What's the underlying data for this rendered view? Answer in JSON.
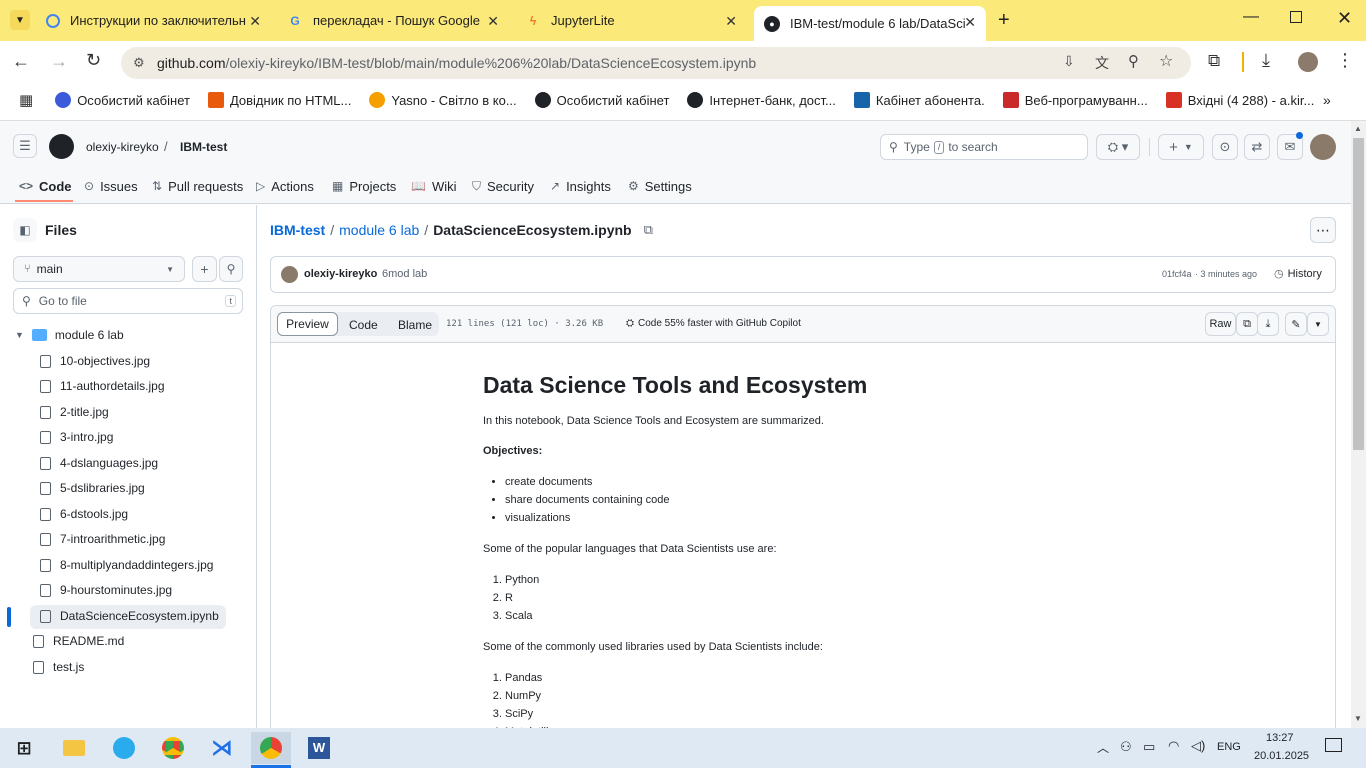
{
  "browser": {
    "tabs": [
      {
        "title": "Инструкции по заключительн",
        "icon": "google-classroom-icon",
        "color": "#4285f4"
      },
      {
        "title": "перекладач - Пошук Google",
        "icon": "google-icon",
        "color": "#ea4335"
      },
      {
        "title": "JupyterLite",
        "icon": "jupyter-icon",
        "color": "#f37726"
      },
      {
        "title": "IBM-test/module 6 lab/DataSci",
        "icon": "github-icon",
        "color": "#1f2328"
      }
    ],
    "url_host": "github.com",
    "url_path": "/olexiy-kireyko/IBM-test/blob/main/module%206%20lab/DataScienceEcosystem.ipynb",
    "bookmarks": [
      {
        "label": "Особистий кабінет",
        "color": "#3b5bdb"
      },
      {
        "label": "Довідник по HTML...",
        "color": "#e8590c"
      },
      {
        "label": "Yasno - Світло в ко...",
        "color": "#f59f00"
      },
      {
        "label": "Особистий кабінет",
        "color": "#1f2328"
      },
      {
        "label": "Інтернет-банк, дост...",
        "color": "#1f2328"
      },
      {
        "label": "Кабінет абонента.",
        "color": "#1864ab"
      },
      {
        "label": "Веб-програмуванн...",
        "color": "#c92a2a"
      },
      {
        "label": "Вхідні (4 288) - a.kir...",
        "color": "#d93025"
      }
    ]
  },
  "github": {
    "owner": "olexiy-kireyko",
    "repo": "IBM-test",
    "search_placeholder_before": "Type",
    "search_key": "/",
    "search_placeholder_after": "to search",
    "nav": [
      {
        "label": "Code",
        "icon": "code-icon"
      },
      {
        "label": "Issues",
        "icon": "issue-icon"
      },
      {
        "label": "Pull requests",
        "icon": "pull-request-icon"
      },
      {
        "label": "Actions",
        "icon": "play-icon"
      },
      {
        "label": "Projects",
        "icon": "table-icon"
      },
      {
        "label": "Wiki",
        "icon": "book-icon"
      },
      {
        "label": "Security",
        "icon": "shield-icon"
      },
      {
        "label": "Insights",
        "icon": "graph-icon"
      },
      {
        "label": "Settings",
        "icon": "gear-icon"
      }
    ]
  },
  "sidebar": {
    "title": "Files",
    "branch": "main",
    "goto_placeholder": "Go to file",
    "goto_key": "t",
    "folder": "module 6 lab",
    "files": [
      "10-objectives.jpg",
      "11-authordetails.jpg",
      "2-title.jpg",
      "3-intro.jpg",
      "4-dslanguages.jpg",
      "5-dslibraries.jpg",
      "6-dstools.jpg",
      "7-introarithmetic.jpg",
      "8-multiplyandaddintegers.jpg",
      "9-hourstominutes.jpg",
      "DataScienceEcosystem.ipynb"
    ],
    "root_files": [
      "README.md",
      "test.js"
    ]
  },
  "file": {
    "breadcrumb_repo": "IBM-test",
    "breadcrumb_folder": "module 6 lab",
    "breadcrumb_file": "DataScienceEcosystem.ipynb",
    "commit_author": "olexiy-kireyko",
    "commit_message": "6mod lab",
    "commit_sha": "01fcf4a",
    "commit_time": "· 3 minutes ago",
    "history_label": "History",
    "tab_preview": "Preview",
    "tab_code": "Code",
    "tab_blame": "Blame",
    "stats": "121 lines (121 loc) · 3.26 KB",
    "copilot": "Code 55% faster with GitHub Copilot",
    "raw_label": "Raw"
  },
  "notebook": {
    "title": "Data Science Tools and Ecosystem",
    "intro": "In this notebook, Data Science Tools and Ecosystem are summarized.",
    "objectives_heading": "Objectives:",
    "objectives": [
      "create documents",
      "share documents containing code",
      "visualizations"
    ],
    "languages_intro": "Some of the popular languages that Data Scientists use are:",
    "languages": [
      "Python",
      "R",
      "Scala"
    ],
    "libraries_intro": "Some of the commonly used libraries used by Data Scientists include:",
    "libraries": [
      "Pandas",
      "NumPy",
      "SciPy",
      "Matplotlib"
    ]
  },
  "taskbar": {
    "lang": "ENG",
    "time": "13:27",
    "date": "20.01.2025"
  }
}
